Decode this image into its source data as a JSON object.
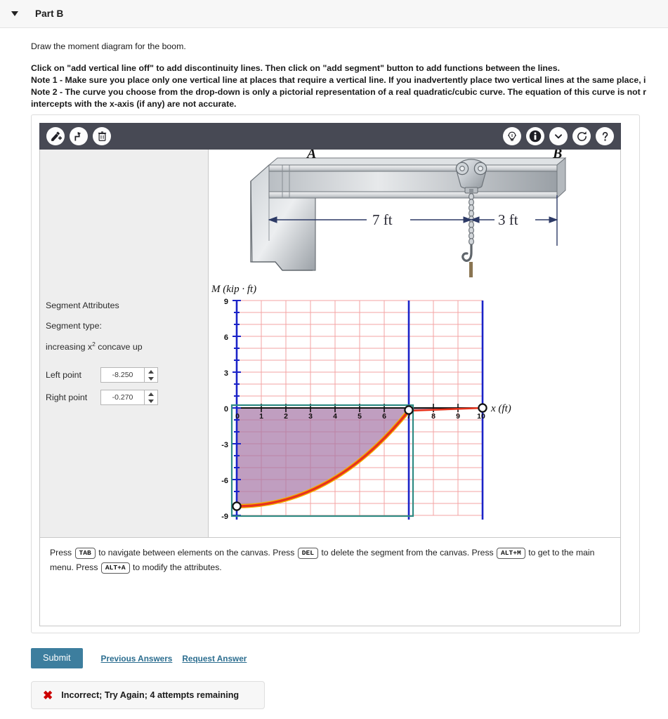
{
  "header": {
    "part_label": "Part B",
    "toggle_icon": "triangle-down-icon"
  },
  "prompt": {
    "intro": "Draw the moment diagram for the boom.",
    "instruction": "Click on \"add vertical line off\" to add discontinuity lines. Then click on \"add segment\" button to add functions between the lines.",
    "note1": "Note 1 - Make sure you place only one vertical line at places that require a vertical line. If you inadvertently place two vertical lines at the same place, i",
    "note2": "Note 2 - The curve you choose from the drop-down is only a pictorial representation of a real quadratic/cubic curve. The equation of this curve is not r",
    "note2_cont": "intercepts with the x-axis (if any) are not accurate."
  },
  "toolbar": {
    "left": [
      {
        "name": "add-segment-icon",
        "title": "add segment"
      },
      {
        "name": "add-vertical-line-icon",
        "title": "add vertical line off"
      },
      {
        "name": "delete-icon",
        "title": "delete"
      }
    ],
    "right": [
      {
        "name": "hint-lightbulb-icon",
        "title": "hint"
      },
      {
        "name": "info-icon",
        "title": "info"
      },
      {
        "name": "chevron-down-icon",
        "title": "more"
      },
      {
        "name": "reset-icon",
        "title": "reset"
      },
      {
        "name": "help-icon",
        "title": "help"
      }
    ]
  },
  "attributes": {
    "panel_title": "Segment Attributes",
    "type_label": "Segment type:",
    "type_value_pre": "increasing x",
    "type_value_sup": "2",
    "type_value_post": " concave up",
    "left_point_label": "Left point",
    "left_point_value": "-8.250",
    "right_point_label": "Right point",
    "right_point_value": "-0.270"
  },
  "beam_diagram": {
    "label_a": "A",
    "label_b": "B",
    "dim_left": "7 ft",
    "dim_right": "3 ft"
  },
  "chart_data": {
    "type": "line",
    "title": "",
    "ylabel": "M (kip · ft)",
    "xlabel": "x (ft)",
    "xlim": [
      0,
      10
    ],
    "ylim": [
      -9,
      9
    ],
    "xticks": [
      "0",
      "1",
      "2",
      "3",
      "4",
      "5",
      "6",
      "7",
      "8",
      "9",
      "10"
    ],
    "yticks": [
      "9",
      "6",
      "3",
      "0",
      "-3",
      "-6",
      "-9"
    ],
    "grid": true,
    "grid_color": "#f2a0a0",
    "axis_color": "#1b23c8",
    "curve_color": "#e8331c",
    "curve_glow_color": "#f5b301",
    "fill_color": "#a878a8",
    "selection_color": "#2e8b84",
    "legend": "none",
    "vertical_lines": [
      0,
      7,
      10
    ],
    "series": [
      {
        "name": "segment-1",
        "shape": "increasing x^2 concave up",
        "x": [
          0,
          1,
          2,
          3,
          4,
          5,
          6,
          7
        ],
        "y": [
          -8.25,
          -8.09,
          -7.6,
          -6.79,
          -5.65,
          -4.18,
          -2.39,
          -0.27
        ],
        "endpoints": [
          [
            0,
            -8.25
          ],
          [
            7,
            -0.27
          ]
        ]
      },
      {
        "name": "segment-2",
        "shape": "linear",
        "x": [
          7,
          10
        ],
        "y": [
          -0.27,
          0
        ],
        "endpoints": [
          [
            7,
            -0.27
          ],
          [
            10,
            0
          ]
        ]
      }
    ],
    "selected_segment": "segment-1"
  },
  "canvas_help": {
    "p1": "Press ",
    "k1": "TAB",
    "p2": " to navigate between elements on the canvas. Press ",
    "k2": "DEL",
    "p3": " to delete the segment from the canvas. Press ",
    "k3": "ALT+M",
    "p4": " to get to the main menu. Press ",
    "k4": "ALT+A",
    "p5": " to modify the attributes."
  },
  "actions": {
    "submit_label": "Submit",
    "previous_answers_label": "Previous Answers",
    "request_answer_label": "Request Answer"
  },
  "feedback": {
    "icon": "x-mark-icon",
    "message": "Incorrect; Try Again; 4 attempts remaining"
  },
  "colors": {
    "toolbar_bg": "#474954",
    "submit_blue": "#3d7e9e",
    "link_blue": "#2b6d8f",
    "error_red": "#cc0000"
  }
}
